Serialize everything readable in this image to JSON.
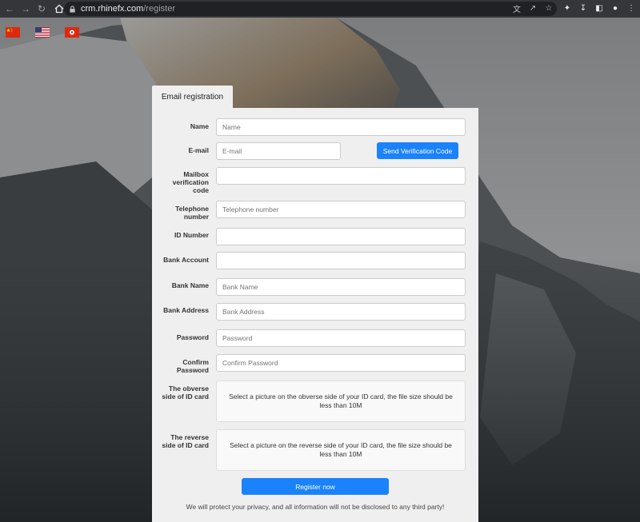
{
  "browser": {
    "url_host": "crm.rhinefx.com",
    "url_path": "/register"
  },
  "icons": {
    "back": "back-arrow-icon",
    "forward": "forward-arrow-icon",
    "reload": "reload-icon",
    "home": "home-icon",
    "lock": "lock-icon",
    "translate": "translate-icon",
    "share": "share-icon",
    "bookmark": "star-icon",
    "extensions": "puzzle-icon",
    "download": "download-icon",
    "sidebar": "sidebar-icon",
    "profile": "profile-icon",
    "menu": "kebab-menu-icon"
  },
  "languages": [
    {
      "name": "chinese-flag"
    },
    {
      "name": "us-flag"
    },
    {
      "name": "hong-kong-flag"
    }
  ],
  "form": {
    "tab_label": "Email registration",
    "fields": {
      "name": {
        "label": "Name",
        "placeholder": "Name"
      },
      "email": {
        "label": "E-mail",
        "placeholder": "E-mail"
      },
      "mailbox_code": {
        "label": "Mailbox verification code",
        "placeholder": ""
      },
      "telephone": {
        "label": "Telephone number",
        "placeholder": "Telephone number"
      },
      "id_number": {
        "label": "ID Number",
        "placeholder": ""
      },
      "bank_account": {
        "label": "Bank Account",
        "placeholder": ""
      },
      "bank_name": {
        "label": "Bank Name",
        "placeholder": "Bank Name"
      },
      "bank_address": {
        "label": "Bank Address",
        "placeholder": "Bank Address"
      },
      "password": {
        "label": "Password",
        "placeholder": "Password"
      },
      "confirm_password": {
        "label": "Confirm Password",
        "placeholder": "Confirm Password"
      },
      "id_obverse": {
        "label": "The obverse side of ID card",
        "text": "Select a picture on the obverse side of your ID card, the file size should be less than 10M"
      },
      "id_reverse": {
        "label": "The reverse side of ID card",
        "text": "Select a picture on the reverse side of your ID card, the file size should be less than 10M"
      }
    },
    "send_code_label": "Send Verification Code",
    "register_label": "Register now",
    "privacy_text": "We will protect your privacy, and all information will not be disclosed to any third party!"
  },
  "colors": {
    "primary_button": "#1a82fb",
    "card_bg": "#efefef"
  }
}
